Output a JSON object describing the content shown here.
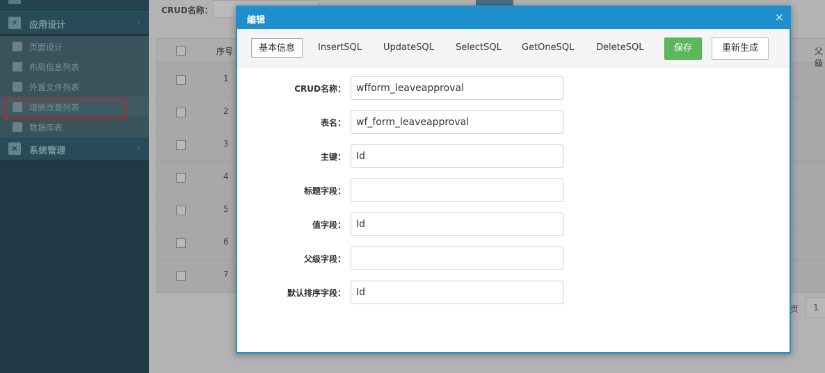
{
  "sidebar": {
    "groups": [
      {
        "label": "应用设计",
        "icon": "lightning-icon"
      },
      {
        "label": "系统管理",
        "icon": "tools-icon"
      }
    ],
    "items": [
      {
        "label": "页面设计",
        "icon": "wrench-icon"
      },
      {
        "label": "布局信息列表",
        "icon": "layout-icon"
      },
      {
        "label": "外置文件列表",
        "icon": "file-icon"
      },
      {
        "label": "增删改查列表",
        "icon": "document-icon"
      },
      {
        "label": "数据库表",
        "icon": "table-icon"
      }
    ]
  },
  "background": {
    "search_label": "CRUD名称：",
    "table_headers": {
      "seq": "序号",
      "parent": "父级"
    },
    "rows": [
      "1",
      "2",
      "3",
      "4",
      "5",
      "6",
      "7"
    ],
    "pager": {
      "text": "页",
      "page": "1"
    }
  },
  "modal": {
    "title": "编辑",
    "close_glyph": "×",
    "tabs": [
      "基本信息",
      "InsertSQL",
      "UpdateSQL",
      "SelectSQL",
      "GetOneSQL",
      "DeleteSQL"
    ],
    "save_label": "保存",
    "regenerate_label": "重新生成",
    "fields": [
      {
        "label": "CRUD名称：",
        "value": "wfform_leaveapproval"
      },
      {
        "label": "表名：",
        "value": "wf_form_leaveapproval"
      },
      {
        "label": "主键：",
        "value": "Id"
      },
      {
        "label": "标题字段：",
        "value": ""
      },
      {
        "label": "值字段：",
        "value": "Id"
      },
      {
        "label": "父级字段：",
        "value": ""
      },
      {
        "label": "默认排序字段：",
        "value": "Id"
      }
    ]
  },
  "colors": {
    "modal_header": "#1e8fcd",
    "save_button": "#5cb85c",
    "highlight_box": "#e03c3c",
    "sidebar": "#2a4a58"
  }
}
